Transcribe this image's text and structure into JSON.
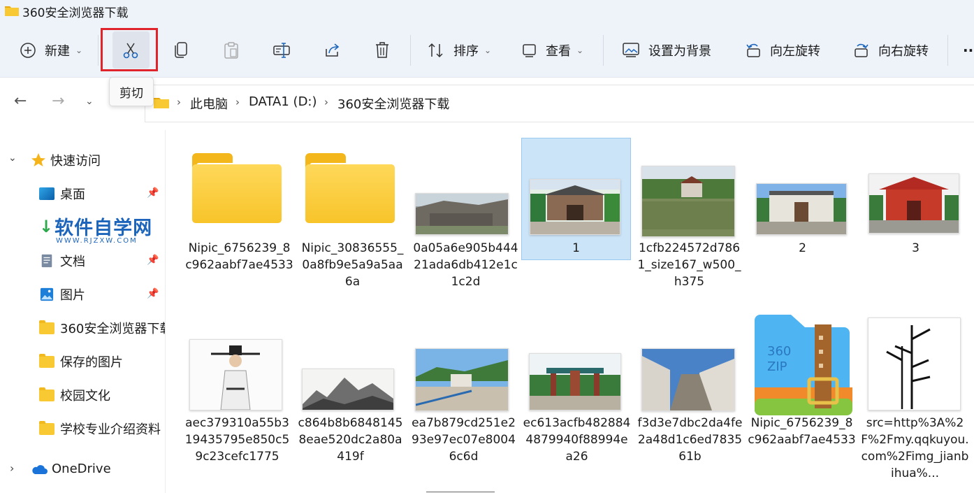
{
  "window": {
    "title": "360安全浏览器下载"
  },
  "toolbar": {
    "new_label": "新建",
    "sort_label": "排序",
    "view_label": "查看",
    "set_bg_label": "设置为背景",
    "rotate_left_label": "向左旋转",
    "rotate_right_label": "向右旋转",
    "more_label": "···",
    "tooltip": "剪切"
  },
  "breadcrumb": [
    "此电脑",
    "DATA1 (D:)",
    "360安全浏览器下载"
  ],
  "sidebar": {
    "quick_access": "快速访问",
    "items": [
      {
        "label": "桌面",
        "icon": "desktop-icon"
      },
      {
        "label": "下载",
        "icon": "download-icon"
      },
      {
        "label": "文档",
        "icon": "document-icon"
      },
      {
        "label": "图片",
        "icon": "pictures-icon"
      },
      {
        "label": "360安全浏览器下载",
        "icon": "folder-icon"
      },
      {
        "label": "保存的图片",
        "icon": "folder-icon"
      },
      {
        "label": "校园文化",
        "icon": "folder-icon"
      },
      {
        "label": "学校专业介绍资料",
        "icon": "folder-icon"
      }
    ],
    "onedrive": "OneDrive"
  },
  "watermark": {
    "title": "软件自学网",
    "url": "WWW.RJZXW.COM"
  },
  "files": [
    {
      "name": "Nipic_6756239_8c962aabf7ae4533",
      "kind": "folder"
    },
    {
      "name": "Nipic_30836555_0a8fb9e5a9a5aa6a",
      "kind": "folder"
    },
    {
      "name": "0a05a6e905b44421ada6db412e1c1c2d",
      "kind": "image"
    },
    {
      "name": "1",
      "kind": "image",
      "selected": true
    },
    {
      "name": "1cfb224572d7861_size167_w500_h375",
      "kind": "image"
    },
    {
      "name": "2",
      "kind": "image"
    },
    {
      "name": "3",
      "kind": "image"
    },
    {
      "name": "aec379310a55b319435795e850c59c23cefc1775",
      "kind": "image"
    },
    {
      "name": "c864b8b68481458eae520dc2a80a419f",
      "kind": "image"
    },
    {
      "name": "ea7b879cd251e293e97ec07e80046c6d",
      "kind": "image"
    },
    {
      "name": "ec613acfb4828844879940f88994ea26",
      "kind": "image"
    },
    {
      "name": "f3d3e7dbc2da4fe2a48d1c6ed783561b",
      "kind": "image"
    },
    {
      "name": "Nipic_6756239_8c962aabf7ae4533",
      "kind": "zip"
    },
    {
      "name": "src=http%3A%2F%2Fmy.qqkuyou.com%2Fimg_jianbihua%...",
      "kind": "image"
    }
  ],
  "zip_icon_text": {
    "line1": "360",
    "line2": "ZIP"
  }
}
